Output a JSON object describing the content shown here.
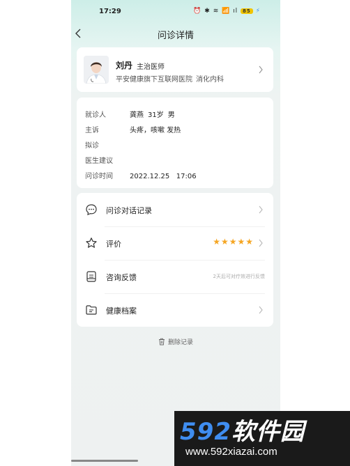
{
  "status_bar": {
    "time": "17:29",
    "icons_text": "⏰ ✱ ≋ 📶 ıl",
    "battery": "85"
  },
  "nav": {
    "title": "问诊详情"
  },
  "doctor": {
    "name": "刘丹",
    "title": "主治医师",
    "hospital": "平安健康旗下互联网医院",
    "department": "消化内科"
  },
  "consultation": {
    "patient_label": "就诊人",
    "patient_name": "龚燕",
    "patient_age": "31岁",
    "patient_gender": "男",
    "complaint_label": "主诉",
    "complaint_value": "头疼，咳嗽 发热",
    "diagnosis_label": "拟诊",
    "diagnosis_value": "",
    "advice_label": "医生建议",
    "advice_value": "",
    "time_label": "问诊时间",
    "time_value": "2022.12.25   17:06"
  },
  "menu": {
    "chat_record": "问诊对话记录",
    "rating": "评价",
    "rating_stars": "★★★★★",
    "rating_value": 5,
    "feedback": "咨询反馈",
    "feedback_hint": "2天后可对疗效进行反馈",
    "health_file": "健康档案"
  },
  "delete": {
    "label": "删除记录"
  },
  "watermark": {
    "number": "592",
    "cn": "软件园",
    "url": "www.592xiazai.com"
  },
  "colors": {
    "star": "#f5a623",
    "header_tint": "#cdeee8",
    "watermark_blue": "#3f8df0"
  }
}
